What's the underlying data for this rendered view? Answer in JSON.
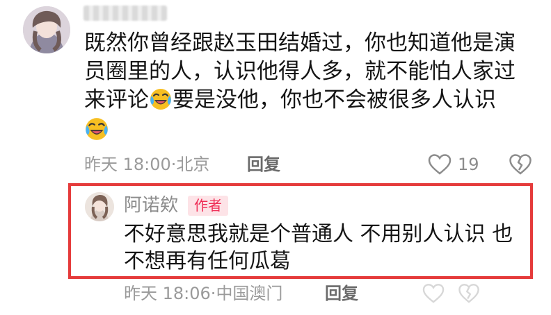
{
  "main_comment": {
    "avatar_icon": "user-avatar-icon",
    "text_parts": [
      "既然你曾经跟赵玉田结婚过，你也知道他是演员圈里的人，认识他得人多，就不能怕人家过来评论",
      "要是没他，你也不会被很多人认识"
    ],
    "emoji_icon": "laughing-crying-emoji-icon",
    "timestamp": "昨天 18:00",
    "location_separator": "·",
    "location": "北京",
    "reply_label": "回复",
    "like_icon": "heart-icon",
    "like_count": "19",
    "dislike_icon": "broken-heart-icon"
  },
  "reply_comment": {
    "avatar_icon": "author-avatar-icon",
    "username": "阿诺欸",
    "badge": "作者",
    "text": "不好意思我就是个普通人 不用别人认识 也不想再有任何瓜葛",
    "timestamp": "昨天 18:06",
    "location_separator": "·",
    "location": "中国澳门",
    "reply_label": "回复",
    "faded_like_icon": "heart-icon",
    "faded_dislike_icon": "broken-heart-icon"
  },
  "colors": {
    "highlight_border": "#e53b3b",
    "author_badge_bg": "#fde3e7",
    "author_badge_text": "#ef2d56",
    "meta_text": "#9a9a9a"
  }
}
